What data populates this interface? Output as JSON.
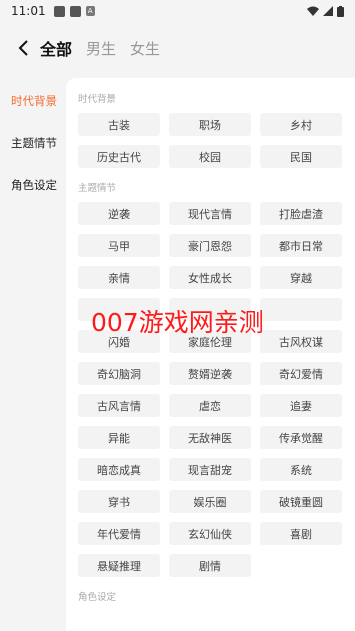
{
  "status_bar": {
    "time": "11:01",
    "badge": "A"
  },
  "header": {
    "tabs": [
      {
        "label": "全部"
      },
      {
        "label": "男生"
      },
      {
        "label": "女生"
      }
    ]
  },
  "sidebar": {
    "items": [
      {
        "label": "时代背景"
      },
      {
        "label": "主题情节"
      },
      {
        "label": "角色设定"
      }
    ]
  },
  "sections": [
    {
      "title": "时代背景",
      "chips": [
        "古装",
        "职场",
        "乡村",
        "历史古代",
        "校园",
        "民国"
      ]
    },
    {
      "title": "主题情节",
      "chips": [
        "逆袭",
        "现代言情",
        "打脸虐渣",
        "马甲",
        "豪门恩怨",
        "都市日常",
        "亲情",
        "女性成长",
        "穿越",
        "",
        "",
        "",
        "闪婚",
        "家庭伦理",
        "古风权谋",
        "奇幻脑洞",
        "赘婿逆袭",
        "奇幻爱情",
        "古风言情",
        "虐恋",
        "追妻",
        "异能",
        "无敌神医",
        "传承觉醒",
        "暗恋成真",
        "现言甜宠",
        "系统",
        "穿书",
        "娱乐圈",
        "破镜重圆",
        "年代爱情",
        "玄幻仙侠",
        "喜剧",
        "悬疑推理",
        "剧情"
      ]
    },
    {
      "title": "角色设定",
      "chips": []
    }
  ],
  "watermark": "007游戏网亲测",
  "colors": {
    "accent": "#f26a2e",
    "watermark": "#ff1a1a"
  }
}
